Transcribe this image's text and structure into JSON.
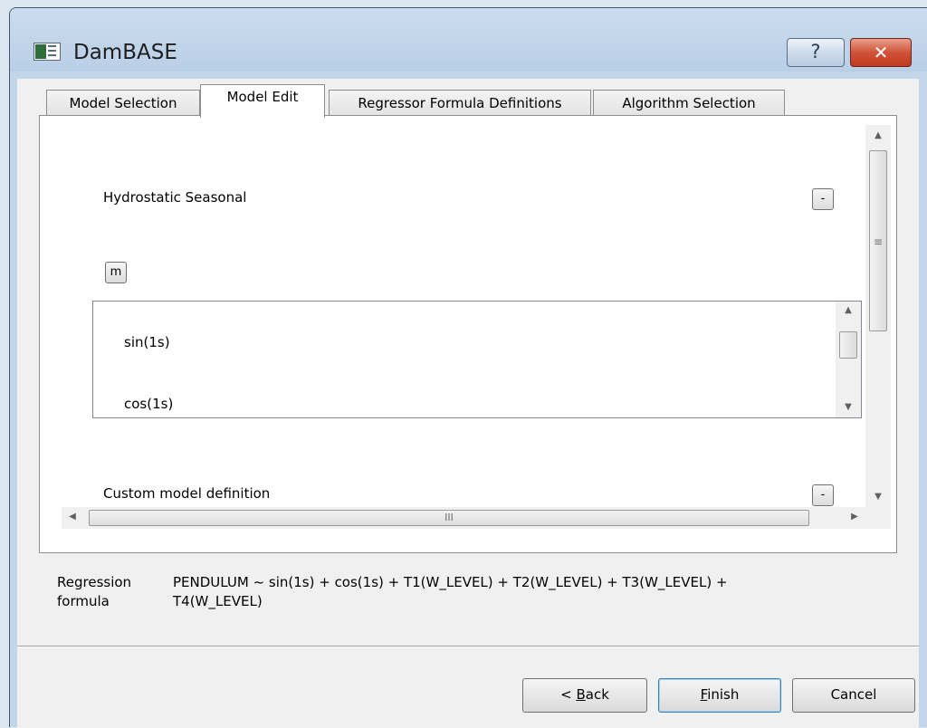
{
  "window": {
    "title": "DamBASE",
    "help_label": "?",
    "close_label": "✕",
    "icon": "app-window-icon"
  },
  "tabs": [
    {
      "label": "Model Selection",
      "active": false
    },
    {
      "label": "Model Edit",
      "active": true
    },
    {
      "label": "Regressor Formula Definitions",
      "active": false
    },
    {
      "label": "Algorithm Selection",
      "active": false
    }
  ],
  "model_edit": {
    "sections": [
      {
        "title": "Hydrostatic Seasonal",
        "collapse_label": "-"
      },
      {
        "title": "Custom model definition",
        "collapse_label": "-"
      }
    ],
    "m_button_label": "m",
    "terms": [
      "sin(1s)",
      "cos(1s)"
    ],
    "scroll_grip": "≡",
    "hscroll_grip": "III"
  },
  "regression": {
    "label_line1": "Regression",
    "label_line2": "formula",
    "formula_line1": "PENDULUM ~ sin(1s) + cos(1s) + T1(W_LEVEL) + T2(W_LEVEL) + T3(W_LEVEL) +",
    "formula_line2": "T4(W_LEVEL)"
  },
  "buttons": {
    "back": {
      "prefix": "< ",
      "mnemonic": "B",
      "rest": "ack"
    },
    "finish": {
      "prefix": "",
      "mnemonic": "F",
      "rest": "inish"
    },
    "cancel": {
      "label": "Cancel"
    }
  },
  "colors": {
    "frame": "#c3d5e8",
    "close": "#c2371f",
    "default_button_border": "#3c7fb1"
  }
}
